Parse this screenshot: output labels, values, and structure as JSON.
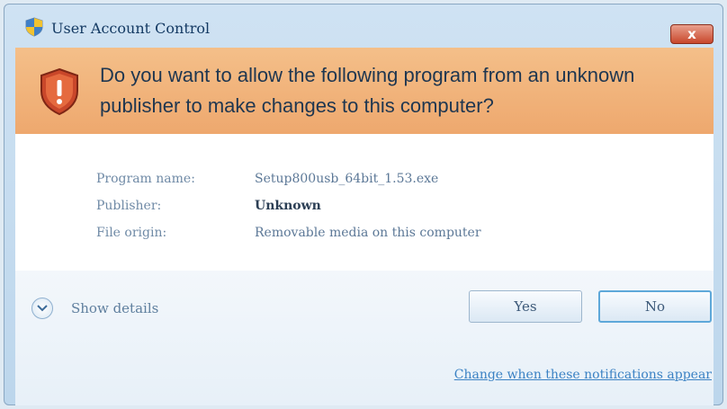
{
  "window": {
    "title": "User Account Control",
    "close_label": "x"
  },
  "banner": {
    "question": "Do you want to allow the following program from an unknown publisher to make changes to this computer?",
    "color": "#f0b27a"
  },
  "details": {
    "rows": [
      {
        "label": "Program name:",
        "value": "Setup800usb_64bit_1.53.exe"
      },
      {
        "label": "Publisher:",
        "value": "Unknown"
      },
      {
        "label": "File origin:",
        "value": "Removable media on this computer"
      }
    ]
  },
  "footer": {
    "show_details_label": "Show details",
    "yes_label": "Yes",
    "no_label": "No",
    "notifications_link": "Change when these notifications appear"
  },
  "icons": {
    "title": "uac-shield-icon",
    "banner": "warning-shield-icon",
    "details": "chevron-down-icon"
  }
}
